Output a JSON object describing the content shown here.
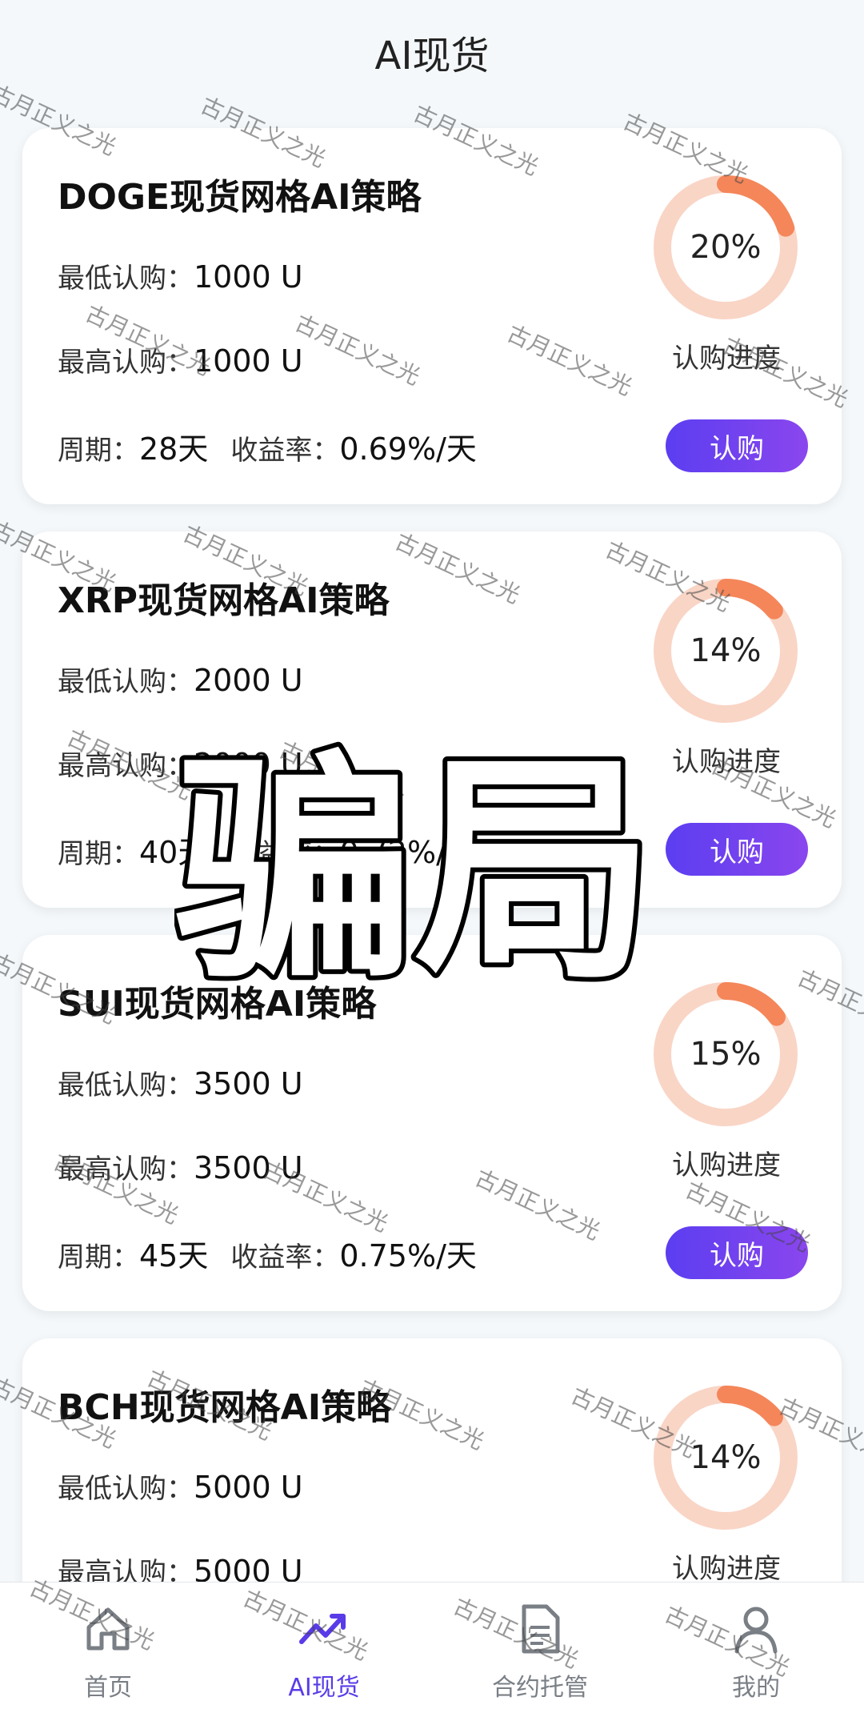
{
  "header": {
    "title": "AI现货"
  },
  "labels": {
    "min": "最低认购：",
    "max": "最高认购：",
    "period": "周期：",
    "rate": "收益率：",
    "progress": "认购进度",
    "subscribe": "认购"
  },
  "cards": [
    {
      "title": "DOGE现货网格AI策略",
      "min": "1000 U",
      "max": "1000 U",
      "period": "28天",
      "rate": "0.69%/天",
      "progress_text": "20%",
      "progress_fraction": 0.2
    },
    {
      "title": "XRP现货网格AI策略",
      "min": "2000 U",
      "max": "2000 U",
      "period": "40天",
      "rate": "0.72%/天",
      "progress_text": "14%",
      "progress_fraction": 0.14
    },
    {
      "title": "SUI现货网格AI策略",
      "min": "3500 U",
      "max": "3500 U",
      "period": "45天",
      "rate": "0.75%/天",
      "progress_text": "15%",
      "progress_fraction": 0.15
    },
    {
      "title": "BCH现货网格AI策略",
      "min": "5000 U",
      "max": "5000 U",
      "period": "",
      "rate": "",
      "progress_text": "14%",
      "progress_fraction": 0.14
    }
  ],
  "tabbar": {
    "items": [
      {
        "label": "首页",
        "icon": "home-icon"
      },
      {
        "label": "AI现货",
        "icon": "trend-chart-icon"
      },
      {
        "label": "合约托管",
        "icon": "document-icon"
      },
      {
        "label": "我的",
        "icon": "user-icon"
      }
    ],
    "active_index": 1
  },
  "overlay": {
    "stamp_text": "骗局",
    "watermark_text": "古月正义之光"
  },
  "colors": {
    "accent": "#5a3be8",
    "button_start": "#5b3ef0",
    "button_end": "#8a46ee",
    "ring_track": "#f9d5c6",
    "ring_fill": "#f4865a"
  }
}
